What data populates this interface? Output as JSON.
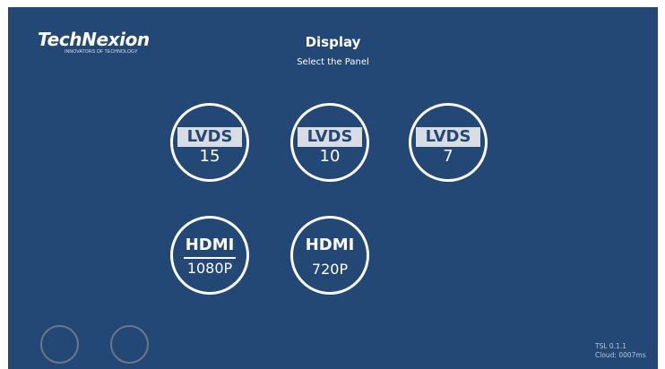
{
  "app": {
    "logo": "TechNexion",
    "tagline": "INNOVATORS OF TECHNOLOGY"
  },
  "header": {
    "title": "Display",
    "subtitle": "Select the Panel"
  },
  "panels": [
    {
      "type": "LVDS",
      "value": "15"
    },
    {
      "type": "LVDS",
      "value": "10"
    },
    {
      "type": "LVDS",
      "value": "7"
    },
    {
      "type": "HDMI",
      "value": "1080P"
    },
    {
      "type": "HDMI",
      "value": "720P"
    }
  ],
  "footer": {
    "version": "TSL 0.1.1",
    "cloud": "Cloud: 0007ms"
  },
  "colors": {
    "background": "#234875",
    "foreground": "#ffffff",
    "lvds_bar": "#d9dde3",
    "ghost_ring": "#6b7786"
  }
}
